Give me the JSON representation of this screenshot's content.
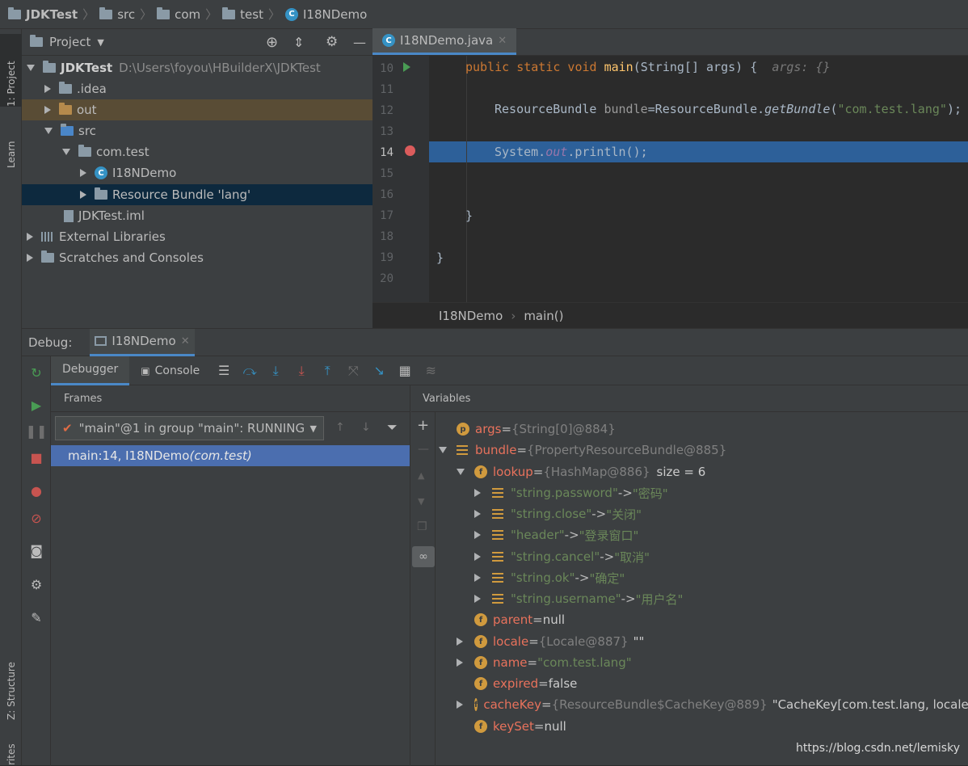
{
  "nav": {
    "project": "JDKTest",
    "crumbs": [
      "src",
      "com",
      "test",
      "I18NDemo"
    ]
  },
  "sidebar_left": {
    "tab_project": "1: Project",
    "tab_learn": "Learn",
    "tab_structure": "Z: Structure",
    "tab_favorites": "rites"
  },
  "project": {
    "header": "Project",
    "tree": [
      {
        "label": "JDKTest",
        "path": "D:\\Users\\foyou\\HBuilderX\\JDKTest"
      },
      {
        "label": ".idea"
      },
      {
        "label": "out"
      },
      {
        "label": "src"
      },
      {
        "label": "com.test"
      },
      {
        "label": "I18NDemo"
      },
      {
        "label": "Resource Bundle 'lang'"
      },
      {
        "label": "JDKTest.iml"
      },
      {
        "label": "External Libraries"
      },
      {
        "label": "Scratches and Consoles"
      }
    ]
  },
  "editor": {
    "tab": "I18NDemo.java",
    "line_numbers": [
      "10",
      "11",
      "12",
      "13",
      "14",
      "15",
      "16",
      "17",
      "18",
      "19",
      "20"
    ],
    "breadcrumb": [
      "I18NDemo",
      "main()"
    ],
    "code": {
      "l10_kw": "public static void ",
      "l10_fn": "main",
      "l10_rest": "(String[] args) {",
      "l10_hint": "args: {}",
      "l12_a": "ResourceBundle ",
      "l12_b": "bundle",
      "l12_c": "=ResourceBundle.",
      "l12_d": "getBundle",
      "l12_e": "(",
      "l12_f": "\"com.test.lang\"",
      "l12_g": ");",
      "l14_a": "System.",
      "l14_b": "out",
      "l14_c": ".println();",
      "l17": "}",
      "l19": "}"
    }
  },
  "debug": {
    "label": "Debug:",
    "session": "I18NDemo",
    "tabs": {
      "debugger": "Debugger",
      "console": "Console"
    },
    "frames_title": "Frames",
    "thread": "\"main\"@1 in group \"main\": RUNNING",
    "frame_main": "main:14, I18NDemo ",
    "frame_pkg": "(com.test)",
    "variables_title": "Variables",
    "vars": [
      {
        "badge": "p",
        "name": "args",
        "eq": " = ",
        "val": "{String[0]@884}"
      },
      {
        "badge": "bars",
        "name": "bundle",
        "eq": " = ",
        "val": "{PropertyResourceBundle@885}"
      },
      {
        "badge": "f",
        "name": "lookup",
        "eq": " = ",
        "val": "{HashMap@886}",
        "extra": "size = 6"
      },
      {
        "key": "\"string.password\"",
        "arrow": " -> ",
        "value": "\"密码\""
      },
      {
        "key": "\"string.close\"",
        "arrow": " -> ",
        "value": "\"关闭\""
      },
      {
        "key": "\"header\"",
        "arrow": " -> ",
        "value": "\"登录窗口\""
      },
      {
        "key": "\"string.cancel\"",
        "arrow": " -> ",
        "value": "\"取消\""
      },
      {
        "key": "\"string.ok\"",
        "arrow": " -> ",
        "value": "\"确定\""
      },
      {
        "key": "\"string.username\"",
        "arrow": " -> ",
        "value": "\"用户名\""
      },
      {
        "badge": "f",
        "name": "parent",
        "eq": " = ",
        "val": "null"
      },
      {
        "badge": "f",
        "name": "locale",
        "eq": " = ",
        "val": "{Locale@887}",
        "extra": "\"\""
      },
      {
        "badge": "f",
        "name": "name",
        "eq": " = ",
        "val": "\"com.test.lang\""
      },
      {
        "badge": "f",
        "name": "expired",
        "eq": " = ",
        "val": "false"
      },
      {
        "badge": "f",
        "name": "cacheKey",
        "eq": " = ",
        "val": "{ResourceBundle$CacheKey@889}",
        "extra": "\"CacheKey[com.test.lang, locale="
      },
      {
        "badge": "f",
        "name": "keySet",
        "eq": " = ",
        "val": "null"
      }
    ]
  },
  "watermark": "https://blog.csdn.net/lemisky"
}
